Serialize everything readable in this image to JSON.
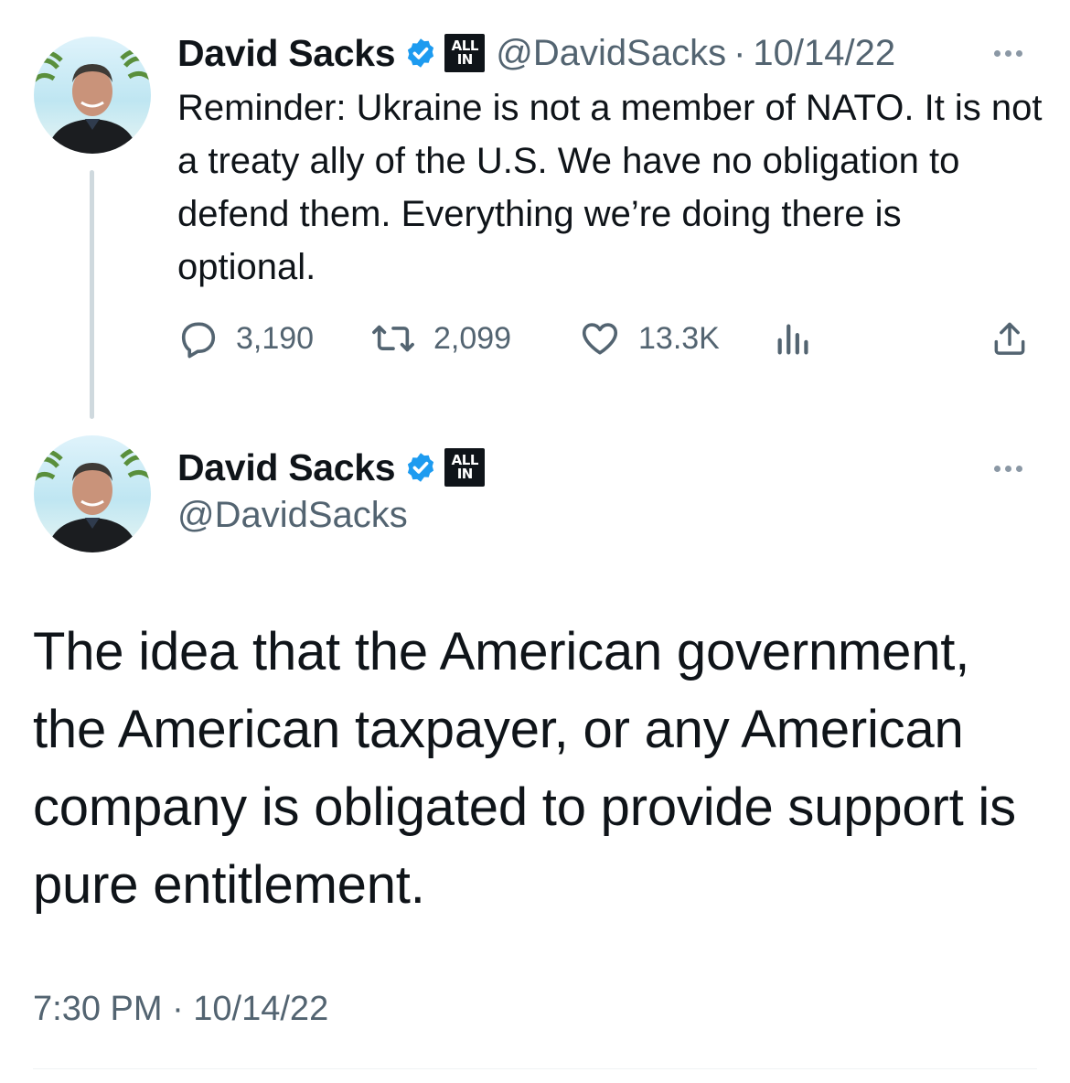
{
  "colors": {
    "verified_blue": "#1d9bf0",
    "text": "#0f1419",
    "muted": "#536471"
  },
  "tweet1": {
    "author": "David Sacks",
    "badge": "ALL IN",
    "badge_line1": "ALL",
    "badge_line2": "IN",
    "handle": "@DavidSacks",
    "separator": "·",
    "date": "10/14/22",
    "text": "Reminder: Ukraine is not a member of NATO. It is not a treaty ally of the U.S. We have no obligation to defend them. Everything we’re doing there is optional.",
    "stats": {
      "replies": "3,190",
      "retweets": "2,099",
      "likes": "13.3K"
    },
    "icons": [
      "reply-icon",
      "retweet-icon",
      "like-icon",
      "analytics-icon",
      "share-icon",
      "more-icon",
      "verified-icon"
    ]
  },
  "tweet2": {
    "author": "David Sacks",
    "badge": "ALL IN",
    "badge_line1": "ALL",
    "badge_line2": "IN",
    "handle": "@DavidSacks",
    "text": "The idea that the American government, the American taxpayer, or any American company is obligated to provide support is pure entitlement.",
    "timestamp": "7:30 PM · 10/14/22"
  }
}
